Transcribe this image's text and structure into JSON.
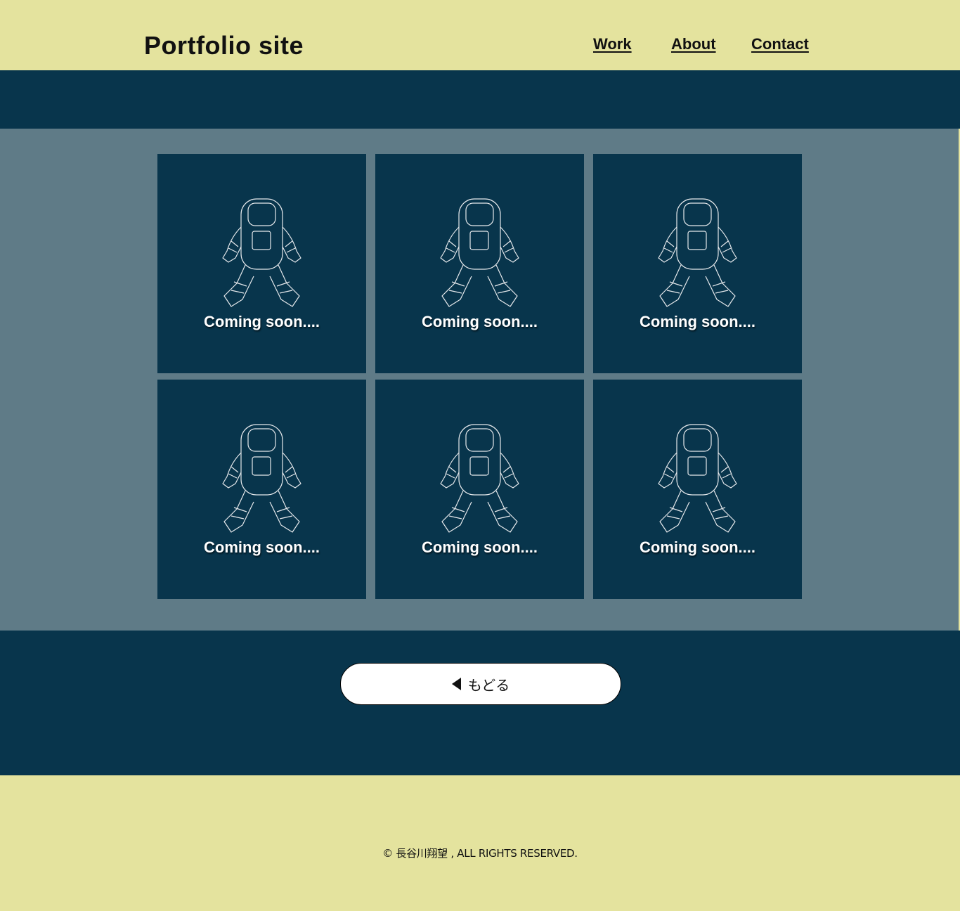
{
  "header": {
    "logo": "Portfolio site",
    "nav": [
      "Work",
      "About",
      "Contact"
    ]
  },
  "works": [
    {
      "caption": "Coming soon...."
    },
    {
      "caption": "Coming soon...."
    },
    {
      "caption": "Coming soon...."
    },
    {
      "caption": "Coming soon...."
    },
    {
      "caption": "Coming soon...."
    },
    {
      "caption": "Coming soon...."
    }
  ],
  "back_button": {
    "label": "もどる"
  },
  "footer": {
    "copyright": "©  長谷川翔望 , ALL RIGHTS RESERVED."
  },
  "colors": {
    "cream": "#e4e39e",
    "navy": "#08354c",
    "slate": "#5f7b87"
  },
  "icons": [
    "astronaut-icon",
    "triangle-left-icon"
  ]
}
